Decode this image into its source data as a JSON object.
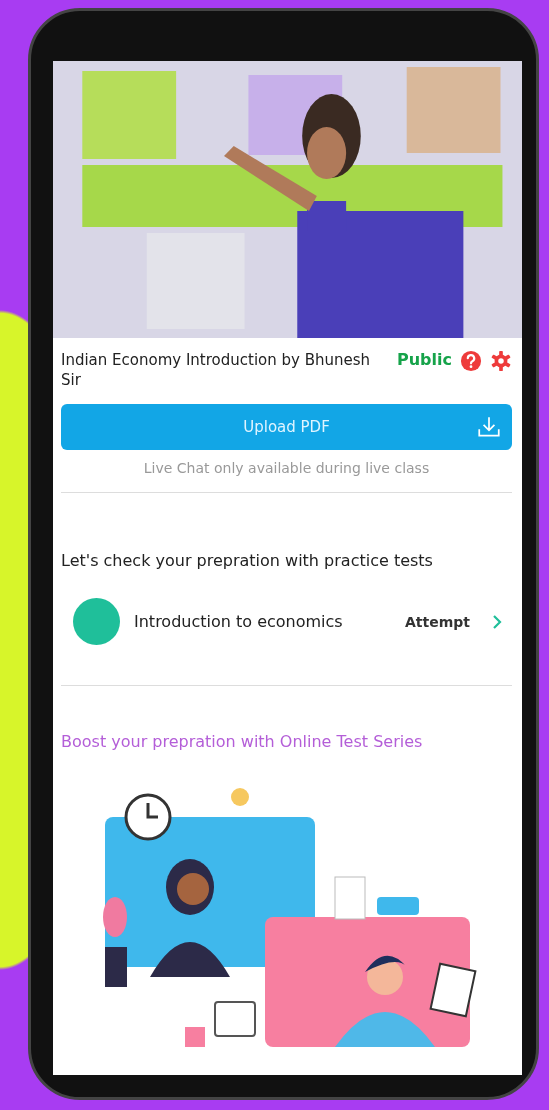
{
  "lesson": {
    "title": "Indian Economy Introduction by Bhunesh Sir",
    "visibility": "Public"
  },
  "upload_button": {
    "label": "Upload PDF"
  },
  "chat_notice": "Live Chat only available during live class",
  "practice": {
    "heading": "Let's check your prepration with practice tests",
    "tests": [
      {
        "name": "Introduction to economics",
        "action": "Attempt"
      }
    ]
  },
  "promo": {
    "heading": "Boost your prepration with Online Test Series"
  }
}
